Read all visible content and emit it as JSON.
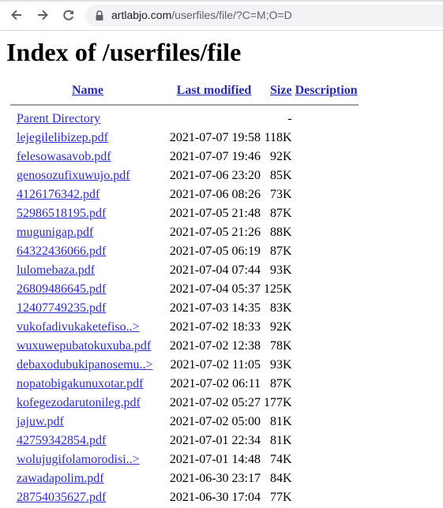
{
  "browser": {
    "url_domain": "artlabjo.com",
    "url_path": "/userfiles/file/?C=M;O=D",
    "icons": {
      "back": "arrow-left",
      "forward": "arrow-right",
      "reload": "reload",
      "secure": "lock"
    }
  },
  "page": {
    "title": "Index of /userfiles/file",
    "columns": {
      "name": "Name",
      "last_modified": "Last modified",
      "size": "Size",
      "description": "Description"
    },
    "parent": {
      "name": "Parent Directory",
      "size": "-"
    },
    "files": [
      {
        "name": "lejegilelibizep.pdf",
        "modified": "2021-07-07 19:58",
        "size": "118K"
      },
      {
        "name": "felesowasavob.pdf",
        "modified": "2021-07-07 19:46",
        "size": "92K"
      },
      {
        "name": "genosozufixuwujo.pdf",
        "modified": "2021-07-06 23:20",
        "size": "85K"
      },
      {
        "name": "4126176342.pdf",
        "modified": "2021-07-06 08:26",
        "size": "73K"
      },
      {
        "name": "52986518195.pdf",
        "modified": "2021-07-05 21:48",
        "size": "87K"
      },
      {
        "name": "mugunigap.pdf",
        "modified": "2021-07-05 21:26",
        "size": "88K"
      },
      {
        "name": "64322436066.pdf",
        "modified": "2021-07-05 06:19",
        "size": "87K"
      },
      {
        "name": "lulomebaza.pdf",
        "modified": "2021-07-04 07:44",
        "size": "93K"
      },
      {
        "name": "26809486645.pdf",
        "modified": "2021-07-04 05:37",
        "size": "125K"
      },
      {
        "name": "12407749235.pdf",
        "modified": "2021-07-03 14:35",
        "size": "83K"
      },
      {
        "name": "vukofadivukaketefiso..>",
        "modified": "2021-07-02 18:33",
        "size": "92K"
      },
      {
        "name": "wuxuwepubatokuxuba.pdf",
        "modified": "2021-07-02 12:38",
        "size": "78K"
      },
      {
        "name": "debaxodubukipanosemu..>",
        "modified": "2021-07-02 11:05",
        "size": "93K"
      },
      {
        "name": "nopatobigakunuxotar.pdf",
        "modified": "2021-07-02 06:11",
        "size": "87K"
      },
      {
        "name": "kofegezodarutonileg.pdf",
        "modified": "2021-07-02 05:27",
        "size": "177K"
      },
      {
        "name": "jajuw.pdf",
        "modified": "2021-07-02 05:00",
        "size": "81K"
      },
      {
        "name": "42759342854.pdf",
        "modified": "2021-07-01 22:34",
        "size": "81K"
      },
      {
        "name": "wolujugifolamorodisi..>",
        "modified": "2021-07-01 14:48",
        "size": "74K"
      },
      {
        "name": "zawadapolim.pdf",
        "modified": "2021-06-30 23:17",
        "size": "84K"
      },
      {
        "name": "28754035627.pdf",
        "modified": "2021-06-30 17:04",
        "size": "77K"
      }
    ]
  }
}
